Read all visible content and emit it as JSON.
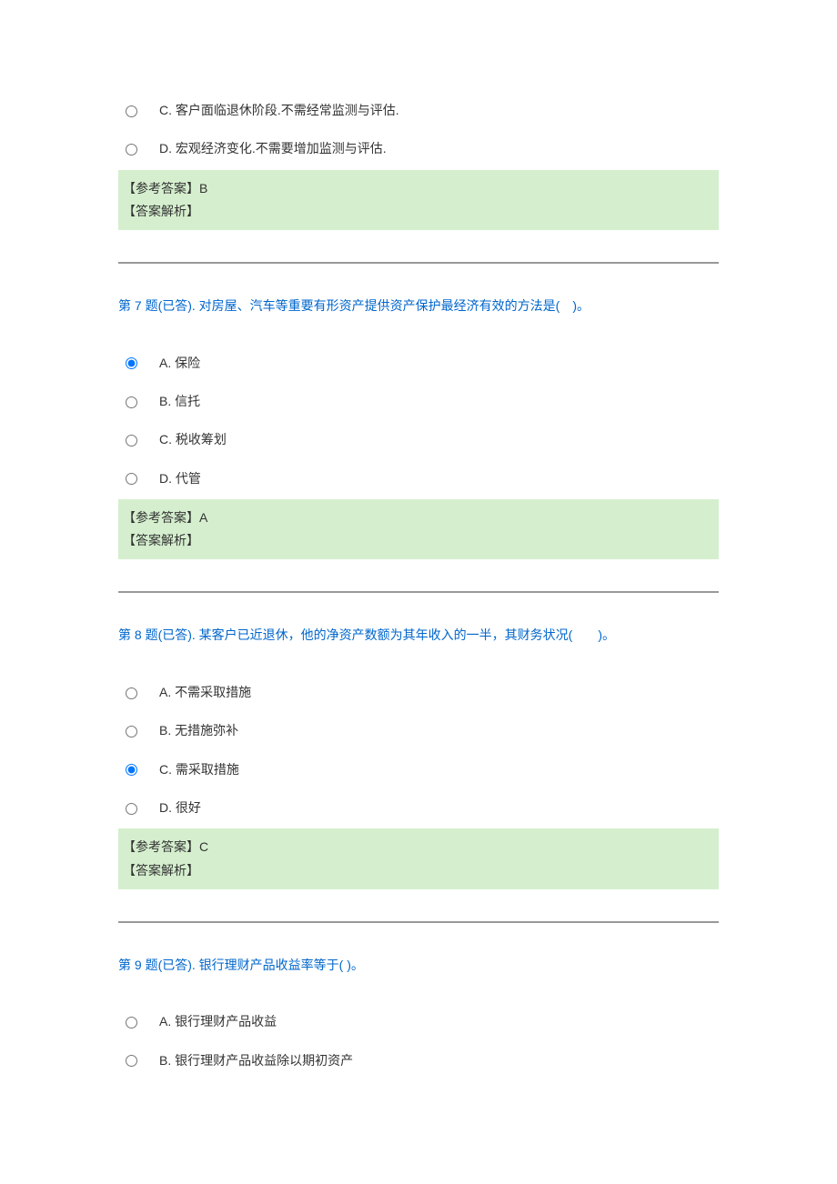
{
  "q6_partial": {
    "options": [
      {
        "label": "C. 客户面临退休阶段.不需经常监测与评估.",
        "selected": false
      },
      {
        "label": "D. 宏观经济变化.不需要增加监测与评估.",
        "selected": false
      }
    ],
    "answerLabel": "【参考答案】",
    "answer": "B",
    "analysisLabel": "【答案解析】"
  },
  "q7": {
    "title": "第 7 题(已答). 对房屋、汽车等重要有形资产提供资产保护最经济有效的方法是(　)。",
    "options": [
      {
        "label": "A. 保险",
        "selected": true
      },
      {
        "label": "B. 信托",
        "selected": false
      },
      {
        "label": "C. 税收筹划",
        "selected": false
      },
      {
        "label": "D. 代管",
        "selected": false
      }
    ],
    "answerLabel": "【参考答案】",
    "answer": "A",
    "analysisLabel": "【答案解析】"
  },
  "q8": {
    "title": "第 8 题(已答). 某客户已近退休，他的净资产数额为其年收入的一半，其财务状况(　　)。",
    "options": [
      {
        "label": "A. 不需采取措施",
        "selected": false
      },
      {
        "label": "B. 无措施弥补",
        "selected": false
      },
      {
        "label": "C. 需采取措施",
        "selected": true
      },
      {
        "label": "D. 很好",
        "selected": false
      }
    ],
    "answerLabel": "【参考答案】",
    "answer": "C",
    "analysisLabel": "【答案解析】"
  },
  "q9": {
    "title": "第 9 题(已答). 银行理财产品收益率等于(  )。",
    "options": [
      {
        "label": "A. 银行理财产品收益",
        "selected": false
      },
      {
        "label": "B. 银行理财产品收益除以期初资产",
        "selected": false
      }
    ]
  }
}
